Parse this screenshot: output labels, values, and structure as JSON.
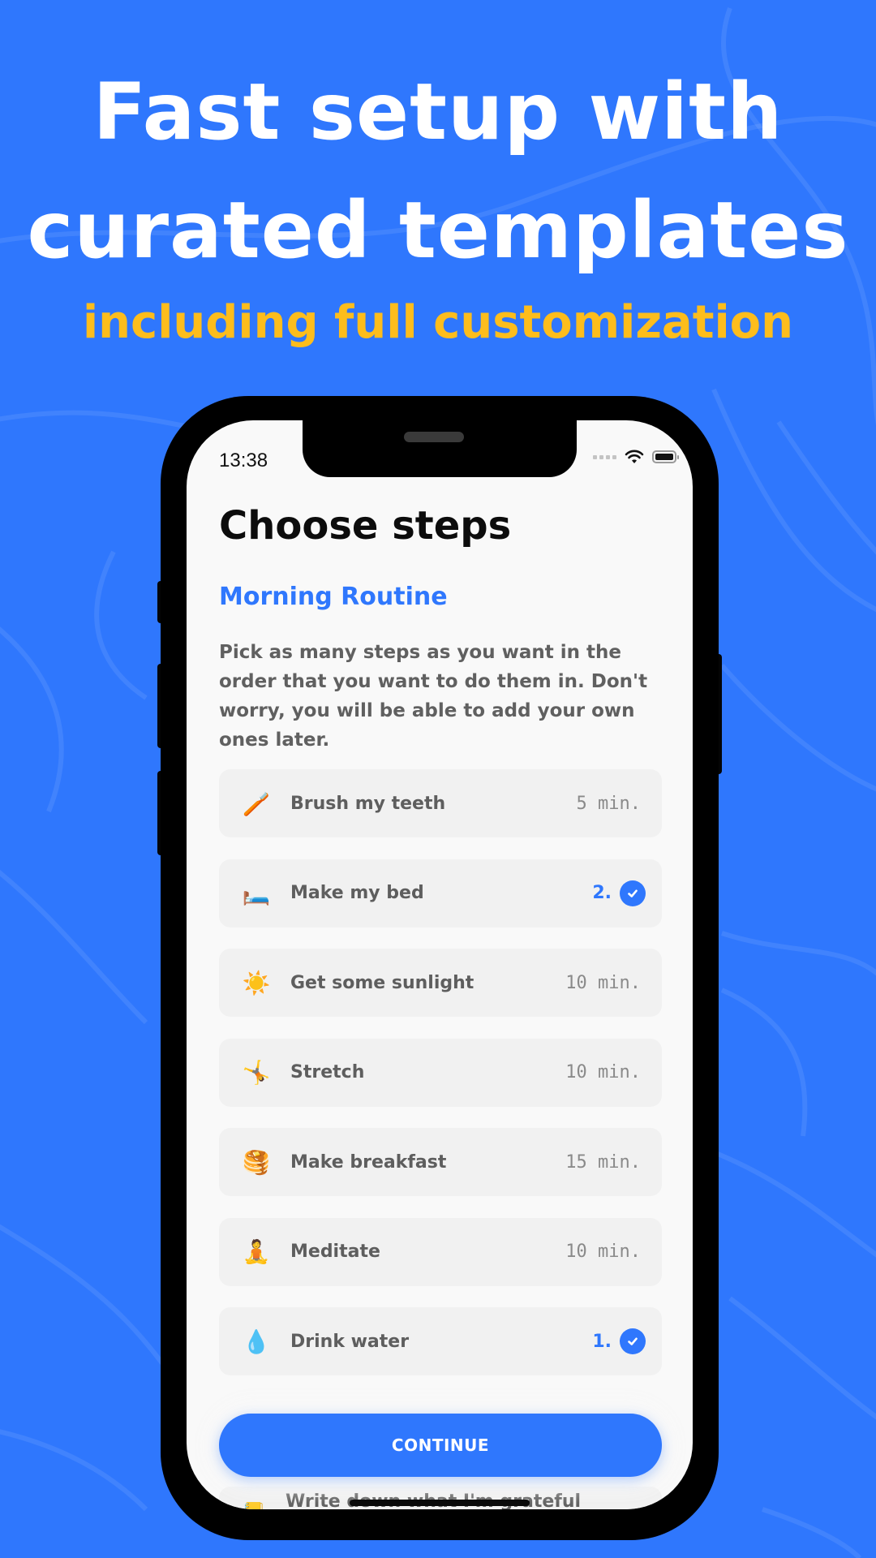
{
  "marketing": {
    "headline_line1": "Fast setup with",
    "headline_line2": "curated templates",
    "subheadline": "including full customization",
    "colors": {
      "background": "#2f77fd",
      "subheadline": "#fdbd1c",
      "headline": "#ffffff"
    }
  },
  "status_bar": {
    "time": "13:38",
    "icons": [
      "signal-icon",
      "wifi-icon",
      "battery-icon"
    ]
  },
  "screen": {
    "title": "Choose steps",
    "routine_name": "Morning Routine",
    "description": "Pick as many steps as you want in the order that you want to do them in. Don't worry, you will be able to add your own ones later.",
    "accent_color": "#2f77fd",
    "steps": [
      {
        "emoji": "🪥",
        "icon": "toothbrush-icon",
        "label": "Brush my teeth",
        "duration": "5 min.",
        "selected": false,
        "order": ""
      },
      {
        "emoji": "🛏️",
        "icon": "bed-icon",
        "label": "Make my bed",
        "duration": "",
        "selected": true,
        "order": "2."
      },
      {
        "emoji": "☀️",
        "icon": "sun-icon",
        "label": "Get some sunlight",
        "duration": "10 min.",
        "selected": false,
        "order": ""
      },
      {
        "emoji": "🤸",
        "icon": "cartwheel-icon",
        "label": "Stretch",
        "duration": "10 min.",
        "selected": false,
        "order": ""
      },
      {
        "emoji": "🥞",
        "icon": "pancakes-icon",
        "label": "Make breakfast",
        "duration": "15 min.",
        "selected": false,
        "order": ""
      },
      {
        "emoji": "🧘",
        "icon": "meditation-icon",
        "label": "Meditate",
        "duration": "10 min.",
        "selected": false,
        "order": ""
      },
      {
        "emoji": "💧",
        "icon": "water-drop-icon",
        "label": "Drink water",
        "duration": "",
        "selected": true,
        "order": "1."
      }
    ],
    "partial_step": {
      "emoji": "📒",
      "icon": "notebook-icon",
      "label": "Write down what I'm grateful"
    },
    "continue_label": "CONTINUE"
  }
}
